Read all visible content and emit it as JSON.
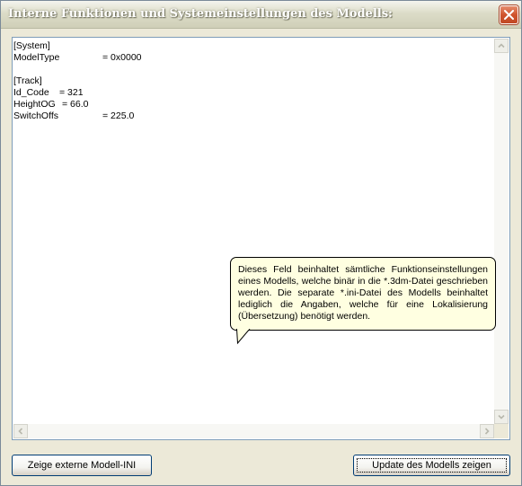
{
  "window": {
    "title": "Interne Funktionen und Systemeinstellungen des Modells:"
  },
  "content_lines": [
    {
      "key": "[System]",
      "value": ""
    },
    {
      "key": "ModelType",
      "value": "= 0x0000"
    },
    {
      "key": "",
      "value": ""
    },
    {
      "key": "[Track]",
      "value": ""
    },
    {
      "key": "Id_Code",
      "value": "= 321"
    },
    {
      "key": "HeightOG",
      "value": "= 66.0"
    },
    {
      "key": "SwitchOffs",
      "value": "= 225.0"
    }
  ],
  "tooltip": {
    "text": "Dieses Feld beinhaltet sämtliche Funktionseinstellungen eines Modells, welche binär in die *.3dm-Datei geschrieben werden. Die separate *.ini-Datei des Modells beinhaltet lediglich die Angaben, welche für eine Lokalisierung (Übersetzung) benötigt werden."
  },
  "buttons": {
    "show_external_ini": "Zeige externe Modell-INI",
    "update_model": "Update des Modells zeigen"
  },
  "colors": {
    "window_bg": "#ece9d8",
    "tooltip_bg": "#ffffe1",
    "close_button": "#d0532c",
    "textbox_border": "#7f9db9"
  }
}
